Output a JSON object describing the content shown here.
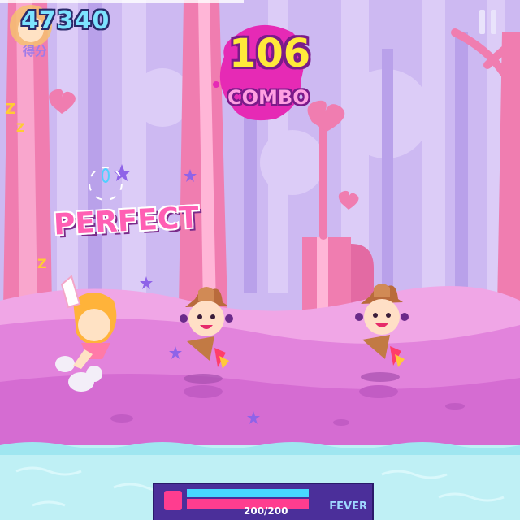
{
  "hud": {
    "score": "47340",
    "score_label": "得分",
    "combo_count": "106",
    "combo_label": "COMBO",
    "judgement": "PERFECT"
  },
  "fever": {
    "value": "200/200",
    "label": "FEVER",
    "fill_fraction": 1.0
  },
  "colors": {
    "sky": "#cbb8f0",
    "tree": "#f06aa8",
    "ground": "#e27ddc",
    "water": "#bff0f5",
    "accent_pink": "#ff3d8f",
    "accent_blue": "#47d8ff"
  }
}
